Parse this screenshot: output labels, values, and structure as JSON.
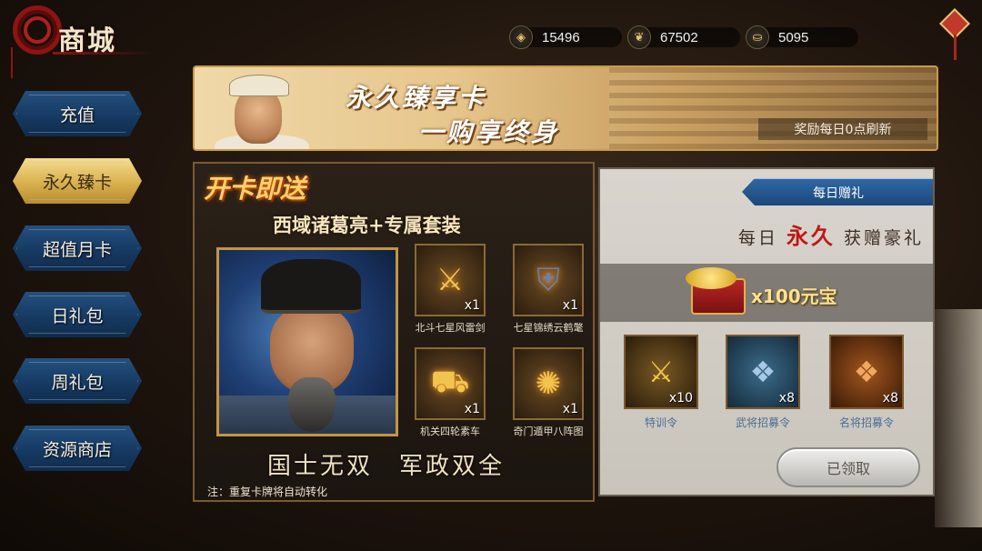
{
  "header": {
    "title": "商城",
    "currencies": [
      {
        "icon": "jade-coin-icon",
        "value": "15496"
      },
      {
        "icon": "grain-icon",
        "value": "67502"
      },
      {
        "icon": "gold-ingot-icon",
        "value": "5095"
      }
    ]
  },
  "sidebar": {
    "items": [
      {
        "label": "充值",
        "active": false
      },
      {
        "label": "永久臻卡",
        "active": true
      },
      {
        "label": "超值月卡",
        "active": false
      },
      {
        "label": "日礼包",
        "active": false
      },
      {
        "label": "周礼包",
        "active": false
      },
      {
        "label": "资源商店",
        "active": false
      }
    ]
  },
  "banner": {
    "line1": "永久臻享卡",
    "line2": "一购享终身",
    "note": "奖励每日0点刷新"
  },
  "left_panel": {
    "title": "开卡即送",
    "subtitle": "西域诸葛亮+专属套装",
    "items": [
      {
        "name": "北斗七星风雷剑",
        "qty": "x1",
        "icon": "sword-icon"
      },
      {
        "name": "七星锦绣云鹤氅",
        "qty": "x1",
        "icon": "robe-icon"
      },
      {
        "name": "机关四轮素车",
        "qty": "x1",
        "icon": "cart-icon"
      },
      {
        "name": "奇门遁甲八阵图",
        "qty": "x1",
        "icon": "scroll-map-icon"
      }
    ],
    "slogan": "国士无双　军政双全",
    "note": "注：重复卡牌将自动转化"
  },
  "right_panel": {
    "tab": "每日赠礼",
    "line_prefix": "每日",
    "line_highlight": "永久",
    "line_suffix": "获赠豪礼",
    "treasure": "x100元宝",
    "rewards": [
      {
        "name": "特训令",
        "qty": "x10",
        "style": "gold"
      },
      {
        "name": "武将招募令",
        "qty": "x8",
        "style": "blue"
      },
      {
        "name": "名将招募令",
        "qty": "x8",
        "style": "orange"
      }
    ],
    "button": "已领取"
  }
}
